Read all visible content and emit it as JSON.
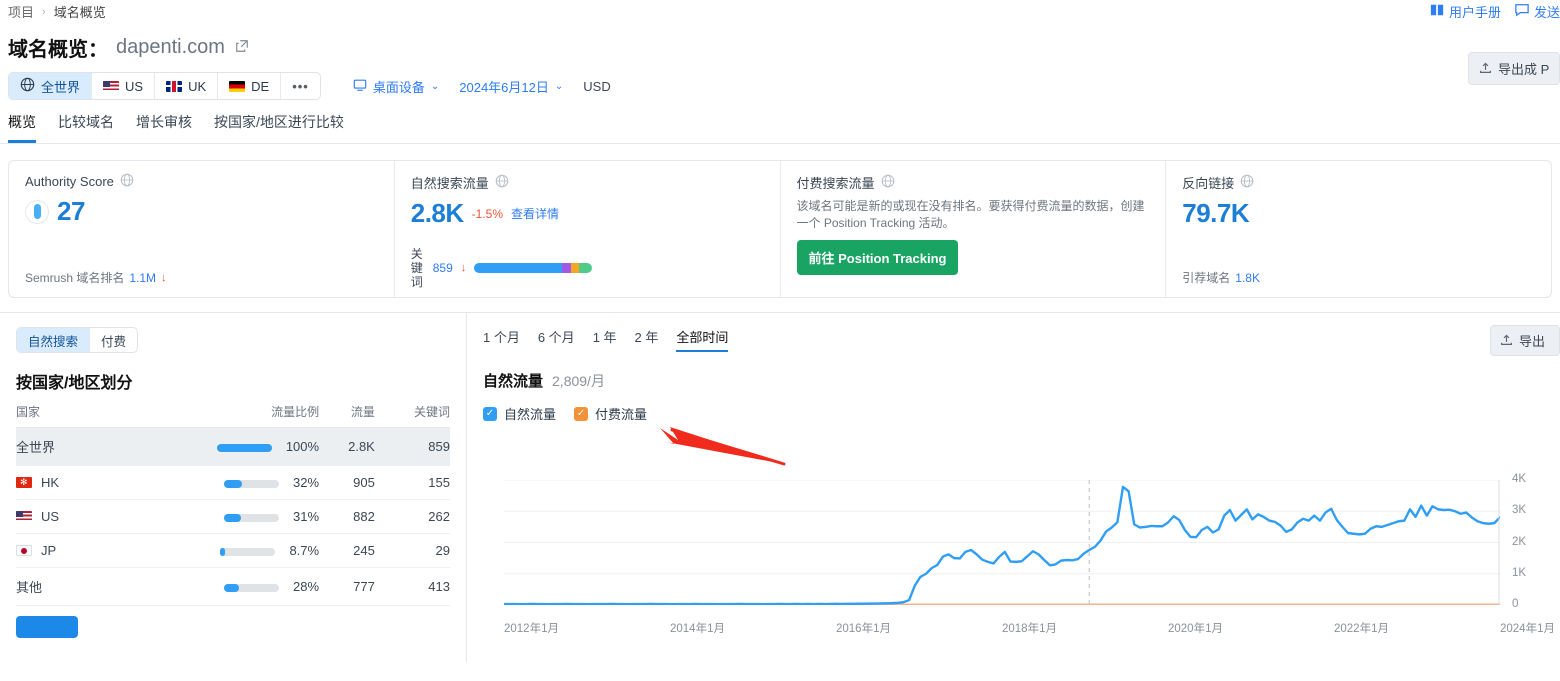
{
  "breadcrumb": {
    "root": "项目",
    "sep": "›",
    "current": "域名概览"
  },
  "toplinks": [
    {
      "label": "用户手册",
      "icon": "book-icon"
    },
    {
      "label": "发送",
      "icon": "feedback-icon"
    }
  ],
  "header": {
    "title": "域名概览：",
    "domain": "dapenti.com",
    "external_icon": "external-link-icon",
    "export_label": "导出成 P"
  },
  "filters": {
    "geo": [
      {
        "label": "全世界",
        "icon": "globe-icon",
        "active": true
      },
      {
        "label": "US",
        "flag": "flag-us",
        "active": false
      },
      {
        "label": "UK",
        "flag": "flag-uk",
        "active": false
      },
      {
        "label": "DE",
        "flag": "flag-de",
        "active": false
      },
      {
        "label": "•••",
        "active": false
      }
    ],
    "device": {
      "label": "桌面设备",
      "icon": "desktop-icon",
      "caret": "⌄"
    },
    "date": {
      "label": "2024年6月12日",
      "caret": "⌄"
    },
    "currency": "USD"
  },
  "nav_tabs": [
    {
      "label": "概览",
      "active": true
    },
    {
      "label": "比较域名",
      "active": false
    },
    {
      "label": "增长审核",
      "active": false
    },
    {
      "label": "按国家/地区进行比较",
      "active": false
    }
  ],
  "cards": {
    "authority": {
      "title": "Authority Score",
      "value": "27",
      "foot_label": "Semrush 域名排名",
      "foot_value": "1.1M",
      "foot_arrow": "↓"
    },
    "organic": {
      "title": "自然搜索流量",
      "value": "2.8K",
      "delta": "-1.5%",
      "link": "查看详情",
      "kw_label": "关键词",
      "kw_value": "859",
      "kw_arrow": "↓",
      "kw_segments": [
        {
          "color": "#2f9ef4",
          "pct": 74
        },
        {
          "color": "#a259e6",
          "pct": 8
        },
        {
          "color": "#f5a623",
          "pct": 7
        },
        {
          "color": "#4ecb8a",
          "pct": 11
        }
      ]
    },
    "paid": {
      "title": "付费搜索流量",
      "description": "该域名可能是新的或现在没有排名。要获得付费流量的数据，创建一个 Position Tracking 活动。",
      "cta": "前往 Position Tracking"
    },
    "backlinks": {
      "title": "反向链接",
      "value": "79.7K",
      "foot_label": "引荐域名",
      "foot_value": "1.8K"
    }
  },
  "left_panel": {
    "segments": [
      {
        "label": "自然搜索",
        "active": true
      },
      {
        "label": "付费",
        "active": false
      }
    ],
    "section_title": "按国家/地区划分",
    "columns": [
      "国家",
      "流量比例",
      "流量",
      "关键词"
    ],
    "rows": [
      {
        "country": "全世界",
        "flag": "",
        "pct_bar": 100,
        "pct": "100%",
        "traffic": "2.8K",
        "keywords": "859",
        "highlight": true,
        "link": false
      },
      {
        "country": "HK",
        "flag": "flag-hk",
        "pct_bar": 32,
        "pct": "32%",
        "traffic": "905",
        "keywords": "155",
        "highlight": false,
        "link": true
      },
      {
        "country": "US",
        "flag": "flag-us",
        "pct_bar": 31,
        "pct": "31%",
        "traffic": "882",
        "keywords": "262",
        "highlight": false,
        "link": true
      },
      {
        "country": "JP",
        "flag": "flag-jp",
        "pct_bar": 8.7,
        "pct": "8.7%",
        "traffic": "245",
        "keywords": "29",
        "highlight": false,
        "link": true
      },
      {
        "country": "其他",
        "flag": "",
        "pct_bar": 28,
        "pct": "28%",
        "traffic": "777",
        "keywords": "413",
        "highlight": false,
        "link": false
      }
    ]
  },
  "chart_panel": {
    "periods": [
      {
        "label": "1 个月",
        "active": false
      },
      {
        "label": "6 个月",
        "active": false
      },
      {
        "label": "1 年",
        "active": false
      },
      {
        "label": "2 年",
        "active": false
      },
      {
        "label": "全部时间",
        "active": true
      }
    ],
    "title": "自然流量",
    "subtitle": "2,809/月",
    "legend": [
      {
        "label": "自然流量",
        "color": "#2f9ef4",
        "checked": true
      },
      {
        "label": "付费流量",
        "color": "#f29339",
        "checked": true
      }
    ],
    "export_label": "导出"
  },
  "chart_data": {
    "type": "line",
    "title": "自然流量",
    "subtitle": "2,809/月",
    "xlabel": "",
    "ylabel": "",
    "ylim": [
      0,
      4000
    ],
    "yticks": [
      0,
      1000,
      2000,
      3000,
      4000
    ],
    "ytick_labels": [
      "0",
      "1K",
      "2K",
      "3K",
      "4K"
    ],
    "xticks": [
      "2012年1月",
      "2014年1月",
      "2016年1月",
      "2018年1月",
      "2020年1月",
      "2022年1月",
      "2024年1月"
    ],
    "x_range": [
      "2012-01",
      "2024-06"
    ],
    "grid": true,
    "legend_position": "top-left",
    "annotation_marker_x": "2019-04",
    "series": [
      {
        "name": "自然流量",
        "color": "#2f9ef4",
        "values": [
          30,
          28,
          30,
          26,
          30,
          32,
          28,
          30,
          26,
          30,
          28,
          32,
          30,
          28,
          30,
          26,
          30,
          28,
          30,
          32,
          28,
          30,
          26,
          30,
          28,
          30,
          32,
          30,
          28,
          30,
          26,
          30,
          28,
          30,
          32,
          30,
          28,
          30,
          26,
          30,
          28,
          30,
          32,
          30,
          28,
          30,
          26,
          30,
          30,
          32,
          30,
          28,
          34,
          30,
          32,
          30,
          34,
          30,
          32,
          36,
          34,
          36,
          38,
          40,
          42,
          44,
          46,
          50,
          55,
          60,
          70,
          90,
          160,
          620,
          900,
          1000,
          1180,
          1280,
          1550,
          1620,
          1500,
          1490,
          1700,
          1760,
          1620,
          1450,
          1380,
          1330,
          1540,
          1700,
          1390,
          1380,
          1400,
          1560,
          1720,
          1620,
          1440,
          1270,
          1300,
          1420,
          1440,
          1430,
          1470,
          1640,
          1760,
          1860,
          2060,
          2350,
          2480,
          2650,
          3780,
          3640,
          2580,
          2480,
          2500,
          2530,
          2520,
          2520,
          2640,
          2840,
          2720,
          2400,
          2180,
          2170,
          2400,
          2500,
          2320,
          2420,
          2860,
          3040,
          2700,
          2880,
          3060,
          2740,
          2900,
          2820,
          2700,
          2660,
          2540,
          2340,
          2420,
          2640,
          2760,
          2700,
          2860,
          2700,
          2960,
          3080,
          2720,
          2500,
          2300,
          2280,
          2260,
          2280,
          2440,
          2520,
          2500,
          2560,
          2620,
          2680,
          2700,
          3060,
          2820,
          3180,
          2860,
          3160,
          3060,
          3040,
          3050,
          3000,
          2920,
          2960,
          2800,
          2680,
          2620,
          2600,
          2620,
          2809
        ]
      },
      {
        "name": "付费流量",
        "color": "#f0b48a",
        "values": [
          0,
          0,
          0,
          0,
          0,
          0,
          0,
          0,
          0,
          0,
          0,
          0,
          0,
          0,
          0,
          0,
          0,
          0,
          0,
          0,
          0,
          0,
          0,
          0,
          0,
          0,
          0,
          0,
          0,
          0,
          0,
          0,
          0,
          0,
          0,
          0,
          0,
          0,
          0,
          0,
          0,
          0,
          0,
          0,
          0,
          0,
          0,
          0,
          0,
          0,
          0,
          0,
          0,
          0,
          0,
          0,
          0,
          0,
          0,
          0,
          0,
          0,
          0,
          0,
          0,
          0,
          0,
          0,
          0,
          0,
          0,
          0,
          0,
          0,
          0,
          0,
          0,
          0,
          0,
          0,
          0,
          0,
          0,
          0,
          0,
          0,
          0,
          0,
          0,
          0,
          0,
          0,
          0,
          0,
          0,
          0,
          0,
          0,
          0,
          0,
          0,
          0,
          0,
          0,
          0,
          0,
          0,
          0,
          0,
          0,
          0,
          0,
          0,
          0,
          0,
          0,
          0,
          0,
          0,
          0,
          0,
          0,
          0,
          0,
          0,
          0,
          0,
          0,
          0,
          0,
          0,
          0,
          0,
          0,
          0,
          0,
          0,
          0,
          0,
          0,
          0,
          0,
          0,
          0,
          0,
          0,
          0,
          0,
          0,
          0,
          0,
          0,
          0,
          0,
          0,
          0,
          0,
          0,
          0,
          0,
          0,
          0,
          0,
          0,
          0,
          0,
          0,
          0,
          0,
          0,
          0,
          0,
          0,
          0,
          0,
          0,
          0,
          0
        ]
      }
    ]
  }
}
